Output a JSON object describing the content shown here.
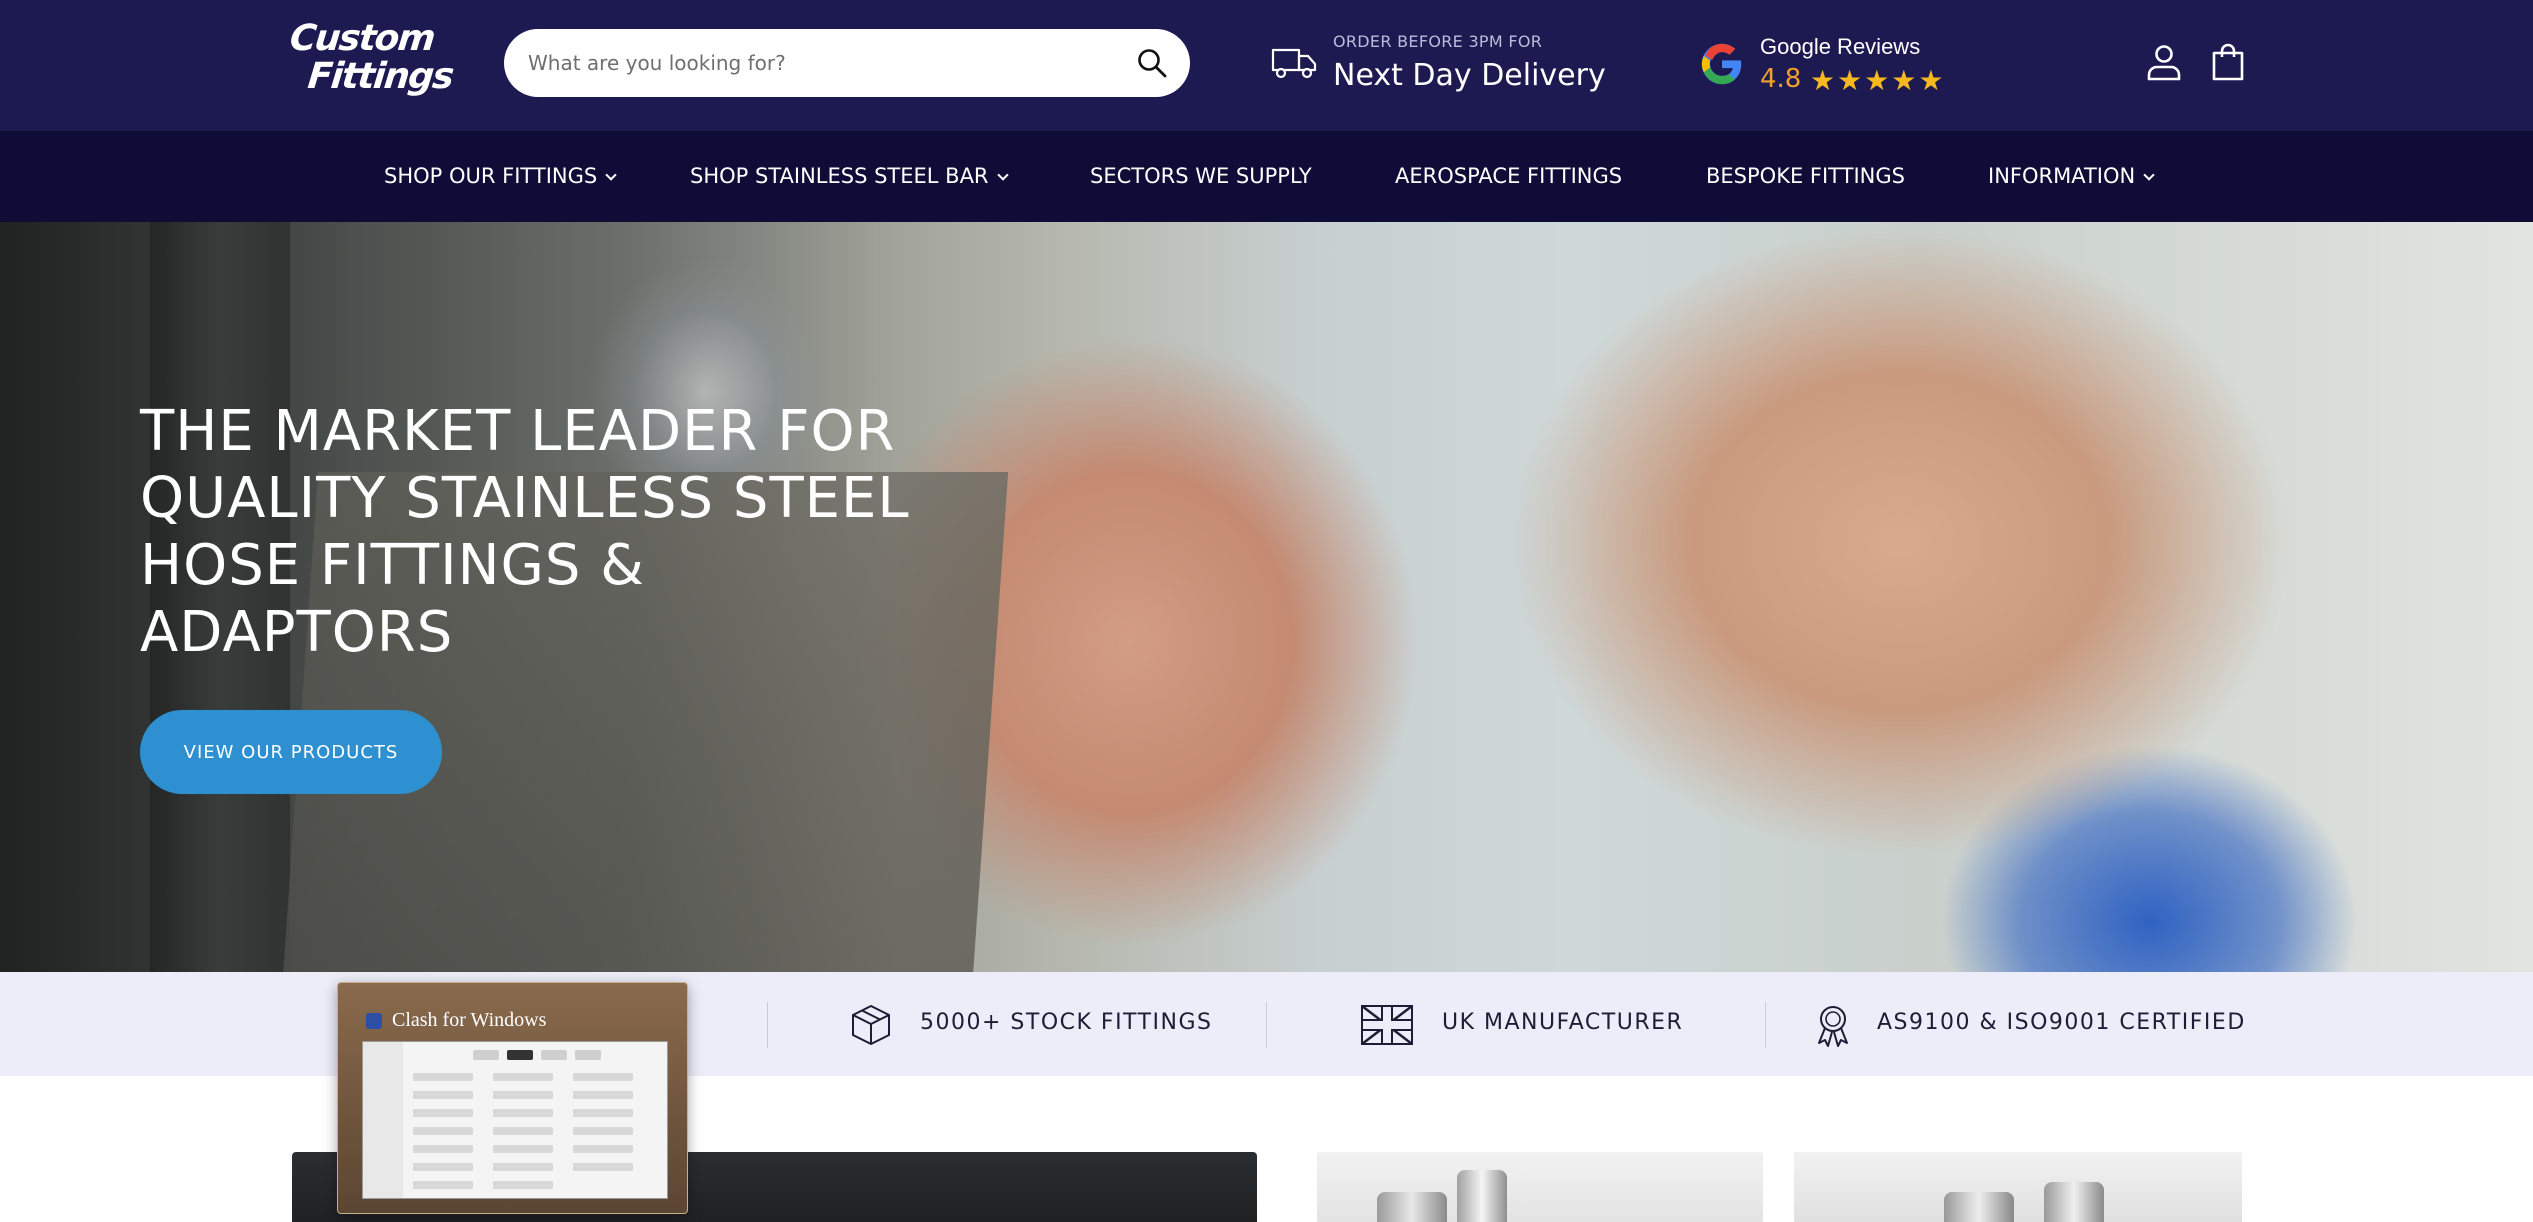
{
  "header": {
    "logo_line1": "Custom",
    "logo_line2": "Fittings",
    "search_placeholder": "What are you looking for?",
    "delivery_small": "ORDER BEFORE 3PM FOR",
    "delivery_big": "Next Day Delivery",
    "reviews_title": "Google Reviews",
    "reviews_rating": "4.8",
    "reviews_stars": "★★★★★"
  },
  "nav": {
    "items": [
      {
        "label": "SHOP OUR FITTINGS",
        "has_dropdown": true
      },
      {
        "label": "SHOP STAINLESS STEEL BAR",
        "has_dropdown": true
      },
      {
        "label": "SECTORS WE SUPPLY",
        "has_dropdown": false
      },
      {
        "label": "AEROSPACE FITTINGS",
        "has_dropdown": false
      },
      {
        "label": "BESPOKE FITTINGS",
        "has_dropdown": false
      },
      {
        "label": "INFORMATION",
        "has_dropdown": true
      }
    ]
  },
  "hero": {
    "title": "THE MARKET LEADER FOR QUALITY STAINLESS STEEL HOSE FITTINGS & ADAPTORS",
    "button_label": "VIEW OUR PRODUCTS"
  },
  "features": {
    "items": [
      {
        "label": "5000+ STOCK FITTINGS",
        "icon": "box-icon"
      },
      {
        "label": "UK MANUFACTURER",
        "icon": "union-flag-icon"
      },
      {
        "label": "AS9100 & ISO9001 CERTIFIED",
        "icon": "award-ribbon-icon"
      }
    ]
  },
  "overlay": {
    "title": "Clash for Windows"
  },
  "colors": {
    "header_bg": "#1d1a52",
    "nav_bg": "#0f0c37",
    "accent_button": "#2e8fd1",
    "rating_orange": "#f09f2a",
    "star_yellow": "#f7b820",
    "features_bg": "#ecedf8"
  }
}
